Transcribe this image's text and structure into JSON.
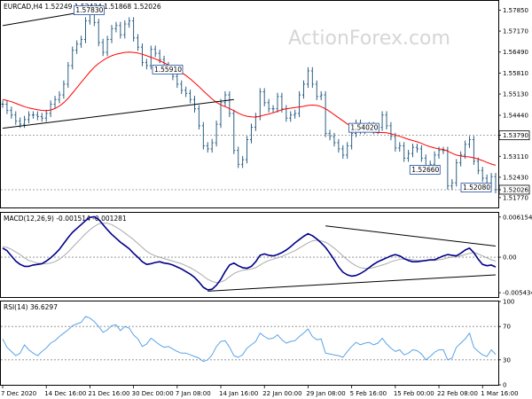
{
  "header": {
    "price": "EURCAD,H4  1.52249 1.52434 1.51868 1.52026",
    "macd": "MACD(12,26,9) -0.001514 -0.001281",
    "rsi": "RSI(14) 36.6297"
  },
  "watermark": "ActionForex.com",
  "chart_data": {
    "type": "line",
    "title": "",
    "price_panel": {
      "ylim": [
        1.5145,
        1.5815
      ],
      "y_ticks": [
        "1.57850",
        "1.57170",
        "1.56490",
        "1.55810",
        "1.55130",
        "1.54440",
        "1.53790",
        "1.53110",
        "1.52430",
        "1.52026",
        "1.51770"
      ],
      "y_tick_values": [
        1.5785,
        1.5717,
        1.5649,
        1.5581,
        1.5513,
        1.5444,
        1.5379,
        1.5311,
        1.5243,
        1.52026,
        1.5177
      ],
      "key_levels": [
        {
          "label": "1.53790",
          "value": 1.5379
        },
        {
          "label": "1.52026",
          "value": 1.52026
        }
      ],
      "annotations": [
        {
          "label": "1.57830",
          "value": 1.5783
        },
        {
          "label": "1.54020",
          "value": 1.5402
        },
        {
          "label": "1.55910",
          "value": 1.5591
        },
        {
          "label": "1.52660",
          "value": 1.5266
        },
        {
          "label": "1.52080",
          "value": 1.5208
        }
      ],
      "close_series": [
        1.548,
        1.546,
        1.5445,
        1.5425,
        1.5415,
        1.543,
        1.5445,
        1.5445,
        1.544,
        1.5435,
        1.545,
        1.548,
        1.5495,
        1.551,
        1.5545,
        1.5605,
        1.5655,
        1.5675,
        1.569,
        1.575,
        1.5783,
        1.5745,
        1.568,
        1.5648,
        1.569,
        1.5725,
        1.5735,
        1.5705,
        1.574,
        1.575,
        1.5695,
        1.5665,
        1.5615,
        1.5605,
        1.5658,
        1.5645,
        1.5625,
        1.5605,
        1.559,
        1.557,
        1.5545,
        1.5525,
        1.5515,
        1.5495,
        1.5465,
        1.541,
        1.5345,
        1.5335,
        1.5355,
        1.5415,
        1.5485,
        1.551,
        1.545,
        1.533,
        1.5285,
        1.53,
        1.5365,
        1.5405,
        1.544,
        1.552,
        1.5485,
        1.5465,
        1.5465,
        1.5505,
        1.5465,
        1.5435,
        1.5445,
        1.545,
        1.551,
        1.5545,
        1.5588,
        1.5545,
        1.5505,
        1.551,
        1.5385,
        1.5375,
        1.5355,
        1.5335,
        1.5315,
        1.5345,
        1.5385,
        1.5418,
        1.5395,
        1.54,
        1.541,
        1.5395,
        1.5405,
        1.5445,
        1.541,
        1.5375,
        1.5338,
        1.5345,
        1.5305,
        1.532,
        1.534,
        1.5335,
        1.5305,
        1.5265,
        1.5285,
        1.5315,
        1.533,
        1.533,
        1.5215,
        1.5225,
        1.529,
        1.5315,
        1.535,
        1.5365,
        1.5295,
        1.5265,
        1.524,
        1.522,
        1.5245,
        1.5203
      ],
      "ma_series": [
        1.5495,
        1.5492,
        1.5488,
        1.5483,
        1.5477,
        1.5472,
        1.5468,
        1.5465,
        1.5462,
        1.546,
        1.5459,
        1.5461,
        1.5466,
        1.5474,
        1.5485,
        1.5499,
        1.5516,
        1.5533,
        1.5551,
        1.5568,
        1.5585,
        1.56,
        1.5612,
        1.5622,
        1.5631,
        1.5637,
        1.5642,
        1.5645,
        1.5648,
        1.5649,
        1.5648,
        1.5646,
        1.5642,
        1.5637,
        1.5632,
        1.5627,
        1.5621,
        1.5614,
        1.5607,
        1.56,
        1.5592,
        1.5583,
        1.5573,
        1.5562,
        1.555,
        1.5537,
        1.5523,
        1.551,
        1.5497,
        1.5486,
        1.5478,
        1.5472,
        1.5466,
        1.5459,
        1.5451,
        1.5445,
        1.5441,
        1.5439,
        1.5438,
        1.5441,
        1.5445,
        1.5448,
        1.5452,
        1.5457,
        1.5462,
        1.5465,
        1.5467,
        1.5469,
        1.5471,
        1.5473,
        1.5476,
        1.5477,
        1.5476,
        1.5472,
        1.5465,
        1.5456,
        1.5446,
        1.5436,
        1.5426,
        1.5416,
        1.5408,
        1.5402,
        1.5397,
        1.5393,
        1.5391,
        1.5389,
        1.5388,
        1.5388,
        1.5387,
        1.5384,
        1.538,
        1.5376,
        1.5371,
        1.5366,
        1.5362,
        1.5358,
        1.5353,
        1.5347,
        1.5342,
        1.5338,
        1.5335,
        1.5333,
        1.5328,
        1.5321,
        1.5315,
        1.5312,
        1.531,
        1.5309,
        1.5306,
        1.5302,
        1.5297,
        1.5291,
        1.5286,
        1.5282
      ]
    },
    "macd_panel": {
      "ylim": [
        -0.0061,
        0.0068
      ],
      "y_ticks": [
        "0.006154",
        "0.00",
        "-0.005434"
      ],
      "y_tick_values": [
        0.006154,
        0.0,
        -0.005434
      ],
      "macd_series": [
        0.0014,
        0.001,
        0.0002,
        -0.0006,
        -0.0011,
        -0.0014,
        -0.0014,
        -0.0012,
        -0.0011,
        -0.001,
        -0.0006,
        -0.0001,
        0.0005,
        0.0012,
        0.0021,
        0.003,
        0.0038,
        0.0044,
        0.005,
        0.0056,
        0.0061,
        0.0062,
        0.0058,
        0.005,
        0.0042,
        0.0035,
        0.0029,
        0.0023,
        0.0018,
        0.0013,
        0.0006,
        0.0,
        -0.0007,
        -0.0011,
        -0.001,
        -0.0008,
        -0.0007,
        -0.0009,
        -0.001,
        -0.0012,
        -0.0015,
        -0.0018,
        -0.0022,
        -0.0026,
        -0.0031,
        -0.0038,
        -0.0046,
        -0.005,
        -0.0049,
        -0.0043,
        -0.0034,
        -0.0022,
        -0.0012,
        -0.0009,
        -0.0013,
        -0.0016,
        -0.0017,
        -0.0014,
        -0.0007,
        0.0003,
        0.0005,
        0.0003,
        0.0002,
        0.0004,
        0.0007,
        0.0011,
        0.0016,
        0.0022,
        0.0027,
        0.0032,
        0.0036,
        0.0033,
        0.0028,
        0.0022,
        0.0015,
        0.0006,
        -0.0004,
        -0.0015,
        -0.0023,
        -0.0027,
        -0.0029,
        -0.0028,
        -0.0025,
        -0.0021,
        -0.0016,
        -0.0011,
        -0.0007,
        -0.0004,
        -0.0001,
        0.0002,
        0.0004,
        0.0002,
        -0.0002,
        -0.0005,
        -0.0007,
        -0.0007,
        -0.0006,
        -0.0005,
        -0.0004,
        -0.0004,
        -0.0001,
        0.0002,
        0.0004,
        0.0003,
        0.0002,
        0.0006,
        0.0011,
        0.0014,
        0.0007,
        -0.0003,
        -0.0011,
        -0.0013,
        -0.0012,
        -0.0015
      ],
      "signal_series": [
        0.0016,
        0.0015,
        0.0012,
        0.0008,
        0.0004,
        -0.0001,
        -0.0005,
        -0.0007,
        -0.0009,
        -0.001,
        -0.001,
        -0.0009,
        -0.0007,
        -0.0003,
        0.0002,
        0.0008,
        0.0015,
        0.0022,
        0.0029,
        0.0036,
        0.0042,
        0.0047,
        0.0051,
        0.0052,
        0.0052,
        0.005,
        0.0046,
        0.0042,
        0.0037,
        0.0032,
        0.0027,
        0.0021,
        0.0015,
        0.0009,
        0.0005,
        0.0002,
        0.0,
        -0.0002,
        -0.0004,
        -0.0006,
        -0.0008,
        -0.001,
        -0.0013,
        -0.0016,
        -0.002,
        -0.0024,
        -0.0029,
        -0.0034,
        -0.0037,
        -0.0039,
        -0.0038,
        -0.0035,
        -0.003,
        -0.0025,
        -0.0022,
        -0.002,
        -0.0019,
        -0.0018,
        -0.0016,
        -0.0012,
        -0.0008,
        -0.0005,
        -0.0003,
        -0.0001,
        0.0001,
        0.0004,
        0.0007,
        0.001,
        0.0014,
        0.0018,
        0.0022,
        0.0025,
        0.0026,
        0.0025,
        0.0023,
        0.0019,
        0.0014,
        0.0008,
        0.0002,
        -0.0004,
        -0.0009,
        -0.0013,
        -0.0016,
        -0.0017,
        -0.0017,
        -0.0016,
        -0.0014,
        -0.0012,
        -0.001,
        -0.0007,
        -0.0005,
        -0.0003,
        -0.0003,
        -0.0003,
        -0.0004,
        -0.0005,
        -0.0005,
        -0.0005,
        -0.0005,
        -0.0005,
        -0.0004,
        -0.0003,
        -0.0001,
        0.0,
        0.0001,
        0.0002,
        0.0004,
        0.0006,
        0.0007,
        0.0005,
        0.0002,
        -0.0001,
        -0.0004,
        -0.0006
      ],
      "trendlines": [
        {
          "from": [
            74,
            0.0048
          ],
          "to": [
            113,
            0.0017
          ]
        },
        {
          "from": [
            47,
            -0.0052
          ],
          "to": [
            113,
            -0.0027
          ]
        }
      ]
    },
    "rsi_panel": {
      "ylim": [
        0,
        100
      ],
      "y_ticks": [
        "100",
        "70",
        "30",
        "0"
      ],
      "y_tick_values": [
        100,
        70,
        30,
        0
      ],
      "levels": [
        70,
        30
      ],
      "rsi_series": [
        55,
        45,
        40,
        35,
        38,
        48,
        42,
        38,
        35,
        40,
        44,
        50,
        53,
        58,
        62,
        66,
        71,
        73,
        75,
        82,
        80,
        76,
        70,
        63,
        66,
        71,
        72,
        65,
        70,
        68,
        60,
        55,
        46,
        49,
        56,
        52,
        48,
        45,
        46,
        43,
        40,
        38,
        38,
        36,
        34,
        32,
        28,
        30,
        36,
        46,
        52,
        53,
        45,
        35,
        33,
        36,
        44,
        48,
        52,
        62,
        58,
        55,
        56,
        60,
        54,
        50,
        52,
        53,
        58,
        62,
        67,
        58,
        54,
        55,
        38,
        37,
        36,
        35,
        33,
        40,
        46,
        51,
        48,
        50,
        51,
        48,
        50,
        56,
        49,
        44,
        40,
        42,
        36,
        38,
        42,
        41,
        37,
        30,
        34,
        39,
        42,
        42,
        30,
        32,
        45,
        50,
        55,
        62,
        45,
        40,
        36,
        34,
        42,
        36.63
      ]
    },
    "x_ticks": [
      {
        "label": "7 Dec 2020",
        "index": 0
      },
      {
        "label": "14 Dec 16:00",
        "index": 10
      },
      {
        "label": "21 Dec 16:00",
        "index": 20
      },
      {
        "label": "30 Dec 00:00",
        "index": 30
      },
      {
        "label": "7 Jan 08:00",
        "index": 40
      },
      {
        "label": "14 Jan 16:00",
        "index": 50
      },
      {
        "label": "22 Jan 00:00",
        "index": 60
      },
      {
        "label": "29 Jan 08:00",
        "index": 70
      },
      {
        "label": "5 Feb 16:00",
        "index": 80
      },
      {
        "label": "15 Feb 00:00",
        "index": 90
      },
      {
        "label": "22 Feb 08:00",
        "index": 100
      },
      {
        "label": "1 Mar 16:00",
        "index": 110
      }
    ],
    "price_trendlines": [
      {
        "from": [
          0,
          1.5735
        ],
        "to": [
          20,
          1.5783
        ]
      },
      {
        "from": [
          0,
          1.5402
        ],
        "to": [
          53,
          1.5495
        ]
      }
    ]
  },
  "colors": {
    "price": "#2b5f83",
    "ma": "#ff0000",
    "macd": "#00008b",
    "signal": "#aaaaaa",
    "rsi": "#5ba3e6",
    "trendline": "#000000",
    "grid_dash": "#888888",
    "watermark": "#d6d6d6"
  }
}
